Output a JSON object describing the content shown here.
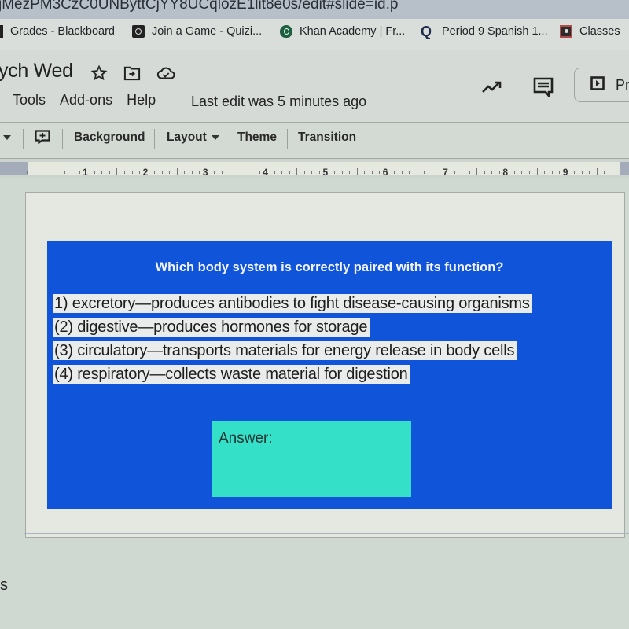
{
  "browser": {
    "url_fragment": "jMezPM3CzC0UNByttCjYY8UCqlozE1lit8e0s/edit#slide=id.p",
    "bookmarks": [
      {
        "label": "Grades - Blackboard",
        "icon": "blackboard-icon"
      },
      {
        "label": "Join a Game - Quizi...",
        "icon": "quizizz-icon"
      },
      {
        "label": "Khan Academy | Fr...",
        "icon": "khan-academy-icon"
      },
      {
        "label": "Period 9 Spanish 1...",
        "icon": "quizlet-icon"
      },
      {
        "label": "Classes",
        "icon": "classroom-icon"
      }
    ]
  },
  "app": {
    "doc_title": "ych Wed",
    "menus": [
      "Tools",
      "Add-ons",
      "Help"
    ],
    "last_edit": "Last edit was 5 minutes ago",
    "present_label": "Pr"
  },
  "toolbar": {
    "items": [
      "Background",
      "Layout",
      "Theme",
      "Transition"
    ]
  },
  "ruler": {
    "numbers": [
      "1",
      "2",
      "3",
      "4",
      "5",
      "6",
      "7",
      "8",
      "9"
    ]
  },
  "slide": {
    "question": "Which body system is correctly paired with its function?",
    "options": [
      "1) excretory—produces antibodies to fight disease-causing organisms",
      "(2) digestive—produces hormones for storage",
      "(3) circulatory—transports materials for energy release in body cells",
      "(4) respiratory—collects waste material for digestion"
    ],
    "answer_label": "Answer:",
    "colors": {
      "background": "#0f54d9",
      "answer_box": "#35e0c9",
      "option_highlight": "#e9ecea"
    }
  },
  "sidebar": {
    "partial_label": "s"
  }
}
